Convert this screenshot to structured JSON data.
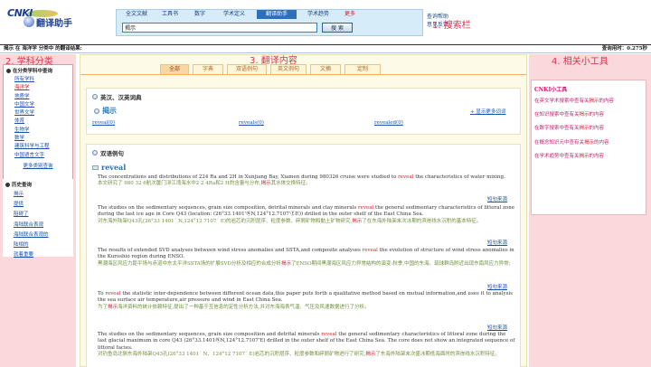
{
  "logo": {
    "cnki": "CNKI",
    "name": "翻译助手"
  },
  "search": {
    "tabs": [
      "全文文献",
      "工具书",
      "数字",
      "学术定义",
      "翻译助手",
      "学术趋势",
      "更多"
    ],
    "active_tab": 4,
    "query": "揭示",
    "button": "搜 索",
    "links": [
      "查询帮助",
      "意见反馈"
    ]
  },
  "annotations": [
    "1. 搜索栏",
    "2. 学科分类",
    "3. 翻译内容",
    "4. 相关小工具"
  ],
  "infobar": {
    "left": "揭示 在 海洋学 分类中 的翻译结果:",
    "right": "查询用时：0.275秒"
  },
  "sidebar": {
    "category_title": "在分类学科中查询",
    "categories": [
      {
        "label": "所有学科",
        "highlight": false
      },
      {
        "label": "海洋学",
        "highlight": true
      },
      {
        "label": "地质学",
        "highlight": false
      },
      {
        "label": "中国文学",
        "highlight": false
      },
      {
        "label": "世界文学",
        "highlight": false
      },
      {
        "label": "体育",
        "highlight": false
      },
      {
        "label": "生物学",
        "highlight": false
      },
      {
        "label": "数学",
        "highlight": false
      },
      {
        "label": "建筑科学与工程",
        "highlight": false
      },
      {
        "label": "中国语言文字",
        "highlight": false
      }
    ],
    "more": "更多类别查询",
    "history_title": "历史查询",
    "history": [
      "揭示",
      "提供",
      "阻碍了",
      "海陆联合表观",
      "海陆联合表观的",
      "陆相的",
      "就着重要"
    ]
  },
  "main": {
    "tabs": [
      "全部",
      "字典",
      "双语例句",
      "英文例句",
      "文摘",
      "定制"
    ],
    "active_tab": 0,
    "dict_title": "英汉、汉英词典",
    "dict_word": "揭示",
    "dict_more": "显示更多词词",
    "dict_entries": [
      "reveal(0)",
      "reveals(0)",
      "revealed(0)"
    ],
    "examples_title": "双语例句",
    "example_word": "reveal",
    "source_label": "短句来源",
    "examples": [
      {
        "en": [
          "The concentrations and distributions of 224 Ra and 2H in Xunjiang Bay, Xiamen during 980326 cruise were studied to ",
          "reveal",
          " the characteristics of water mixing."
        ],
        "zh": [
          "本文研究了 980 32 6航次厦门浔江湾海水中2 2 4Ra和2 H的含量与分布,",
          "揭示",
          "其水体交换特征。"
        ]
      },
      {
        "en": [
          "The studies on the sedimentary sequences, grain size composition, detrital minerals and clay minerals ",
          "reveal",
          " the general sedimentary characteristics of littoral zone during the last ice age in Core Q43 (location: (26°33.1401'ⓃN,124°12.7107'ⒺE)) drilled in the outer shelf of the East China Sea."
        ],
        "zh": [
          "对东海外陆架Q43孔(26°33 1401´ N,124°12 7107´ E)的岩芯的沉积层序、粒度参数、碎屑矿物和黏土矿物研究,",
          "揭示",
          "了在东海外陆架末次冰期的滨岸线水沉积的基本特征。"
        ]
      },
      {
        "en": [
          "The results of extended SVD analyses between wind stress anomalies and SSTA,and composite analyses ",
          "reveal",
          " the evolution of structure of wind stress anomalies in the Kuroshio region during ENSO."
        ],
        "zh": [
          "黑潮海区风应力距平场与赤道中东太平洋SSTA场的扩展SVD分析及相应的合成分析",
          "揭示",
          "了ENSO期间黑潮海区风应力异常结构的演变:秋季,中国的东海、琉球群岛附近出现东南风应力异常;"
        ]
      },
      {
        "en": [
          "To ",
          "reveal",
          " the statistic inter-dependence between different ocean data,this paper puts forth a qualitative method based on mutual information,and uses it to analysis the sea surface air temperature,air pressure and wind in East China Sea."
        ],
        "zh": [
          "为了",
          "揭示",
          "海洋资料的统计依赖特征,提出了一种基于互信息的定性分析方法,并对东海海表气温、气压及风速数据进行了分析。"
        ]
      },
      {
        "en": [
          "The studies on the sedimentary sequences, grain size composition and detrital minerals ",
          "reveal",
          " the general sedimentary characteristics of littoral zone during the last glacial maximum in core Q43 (26°33.1401ⓃN,124°12.7107'E) drilled in the outer shelf of the East China Sea. The core does not show an integrated sequence of littoral facies."
        ],
        "zh": [
          "对钓鱼岛北侧东海外陆架Q43孔(26°33 1401´ N、124°12 7107´ E)岩芯的沉积层序、粒度参数和碎屑矿物进行了研究,",
          "揭示",
          "了东海外陆架末次盛冰期低海面时的滨岸线水沉积特征。"
        ]
      }
    ]
  },
  "tools": {
    "title": "CNKI小工具",
    "items": [
      [
        "在英文学术搜索中查有关",
        "揭示",
        "的内容"
      ],
      [
        "在知识搜索中查有关",
        "揭示",
        "的内容"
      ],
      [
        "在数字搜索中查有关",
        "揭示",
        "的内容"
      ],
      [
        "在概念知识元中查有关",
        "揭示",
        "的内容"
      ],
      [
        "在学术趋势中查有关",
        "揭示",
        "的内容"
      ]
    ]
  },
  "colors": {
    "highlight": "#d0202a",
    "link": "#1b4fb0",
    "tab_active": "#2e6fb7",
    "annotation": "#e0304a"
  }
}
